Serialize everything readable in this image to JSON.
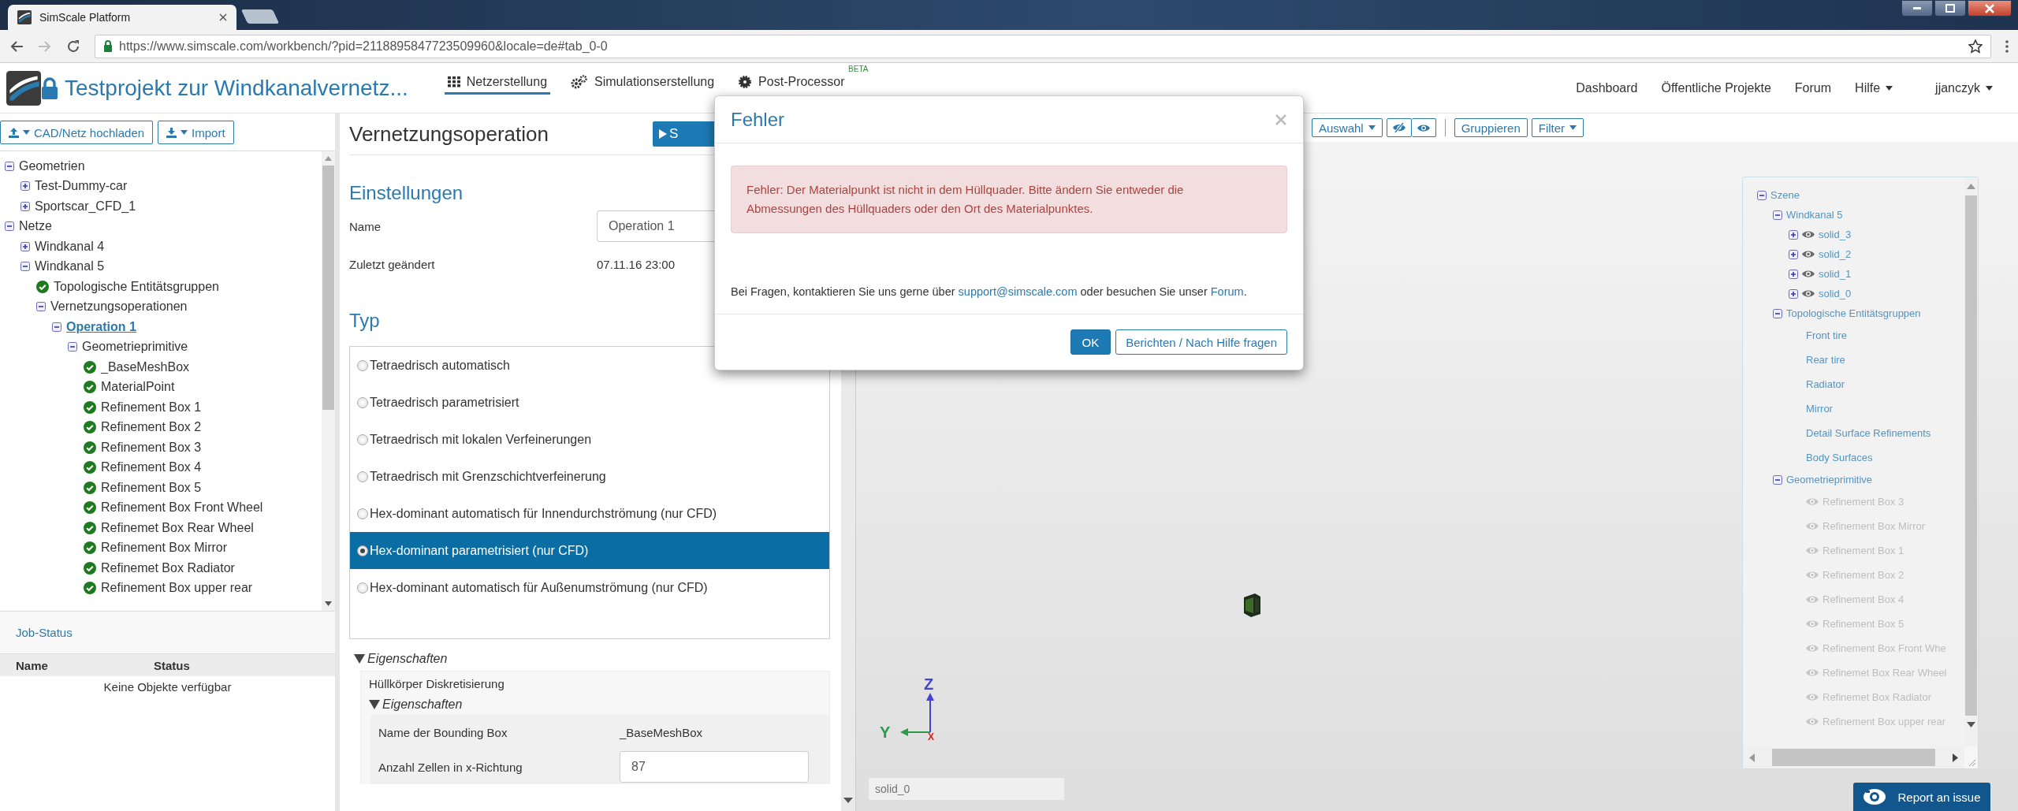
{
  "browser": {
    "tab_title": "SimScale Platform",
    "url": "https://www.simscale.com/workbench/?pid=2118895847723509960&locale=de#tab_0-0"
  },
  "header": {
    "project_title": "Testprojekt zur Windkanalvernetz...",
    "nav": [
      {
        "label": "Netzerstellung",
        "selected": true
      },
      {
        "label": "Simulationserstellung",
        "selected": false
      },
      {
        "label": "Post-Processor",
        "selected": false,
        "badge": "BETA"
      }
    ],
    "links": [
      {
        "label": "Dashboard",
        "dropdown": false
      },
      {
        "label": "Öffentliche Projekte",
        "dropdown": false
      },
      {
        "label": "Forum",
        "dropdown": false
      },
      {
        "label": "Hilfe",
        "dropdown": true
      }
    ],
    "user": "jjanczyk"
  },
  "left_panel": {
    "buttons": [
      "CAD/Netz hochladen",
      "Import"
    ],
    "tree": [
      {
        "label": "Geometrien",
        "kind": "toggle",
        "expanded": true,
        "selected": false,
        "children": [
          {
            "label": "Test-Dummy-car",
            "kind": "toggle",
            "expanded": false,
            "selected": false
          },
          {
            "label": "Sportscar_CFD_1",
            "kind": "toggle",
            "expanded": false,
            "selected": false
          }
        ]
      },
      {
        "label": "Netze",
        "kind": "toggle",
        "expanded": true,
        "selected": false,
        "children": [
          {
            "label": "Windkanal 4",
            "kind": "toggle",
            "expanded": false,
            "selected": false
          },
          {
            "label": "Windkanal 5",
            "kind": "toggle",
            "expanded": true,
            "selected": false,
            "children": [
              {
                "label": "Topologische Entitätsgruppen",
                "kind": "status",
                "selected": false
              },
              {
                "label": "Vernetzungsoperationen",
                "kind": "toggle",
                "expanded": true,
                "selected": false,
                "children": [
                  {
                    "label": "Operation 1",
                    "kind": "toggle",
                    "expanded": true,
                    "selected": true,
                    "children": [
                      {
                        "label": "Geometrieprimitive",
                        "kind": "toggle",
                        "expanded": true,
                        "selected": false,
                        "children": [
                          {
                            "label": "_BaseMeshBox",
                            "kind": "status",
                            "selected": false
                          },
                          {
                            "label": "MaterialPoint",
                            "kind": "status",
                            "selected": false
                          },
                          {
                            "label": "Refinement Box 1",
                            "kind": "status",
                            "selected": false
                          },
                          {
                            "label": "Refinement Box 2",
                            "kind": "status",
                            "selected": false
                          },
                          {
                            "label": "Refinement Box 3",
                            "kind": "status",
                            "selected": false
                          },
                          {
                            "label": "Refinement Box 4",
                            "kind": "status",
                            "selected": false
                          },
                          {
                            "label": "Refinement Box 5",
                            "kind": "status",
                            "selected": false
                          },
                          {
                            "label": "Refinement Box Front Wheel",
                            "kind": "status",
                            "selected": false
                          },
                          {
                            "label": "Refinemet Box Rear Wheel",
                            "kind": "status",
                            "selected": false
                          },
                          {
                            "label": "Refinement Box Mirror",
                            "kind": "status",
                            "selected": false
                          },
                          {
                            "label": "Refinemet Box Radiator",
                            "kind": "status",
                            "selected": false
                          },
                          {
                            "label": "Refinement Box upper rear",
                            "kind": "status",
                            "selected": false
                          }
                        ]
                      }
                    ]
                  }
                ]
              }
            ]
          }
        ]
      }
    ],
    "job_status": {
      "title": "Job-Status",
      "columns": [
        "Name",
        "Status"
      ],
      "empty_text": "Keine Objekte verfügbar"
    }
  },
  "operation": {
    "title": "Vernetzungsoperation",
    "run_button": "S",
    "settings_heading": "Einstellungen",
    "fields": [
      {
        "label": "Name",
        "kind": "input",
        "value": "Operation 1"
      },
      {
        "label": "Zuletzt geändert",
        "kind": "text",
        "value": "07.11.16 23:00"
      }
    ],
    "type_heading": "Typ",
    "type_options": [
      {
        "label": "Tetraedrisch automatisch",
        "selected": false
      },
      {
        "label": "Tetraedrisch parametrisiert",
        "selected": false
      },
      {
        "label": "Tetraedrisch mit lokalen Verfeinerungen",
        "selected": false
      },
      {
        "label": "Tetraedrisch mit Grenzschichtverfeinerung",
        "selected": false
      },
      {
        "label": "Hex-dominant automatisch für Innendurchströmung (nur CFD)",
        "selected": false
      },
      {
        "label": "Hex-dominant parametrisiert (nur CFD)",
        "selected": true
      },
      {
        "label": "Hex-dominant automatisch für Außenumströmung (nur CFD)",
        "selected": false
      }
    ],
    "properties": {
      "title": "Eigenschaften",
      "expanded": true,
      "section": "Hüllkörper Diskretisierung",
      "sub": {
        "title": "Eigenschaften",
        "expanded": true,
        "rows": [
          {
            "label": "Name der Bounding Box",
            "kind": "text",
            "value": "_BaseMeshBox"
          },
          {
            "label": "Anzahl Zellen in x-Richtung",
            "kind": "input",
            "value": "87"
          }
        ]
      }
    }
  },
  "viewer": {
    "toolbar": [
      {
        "kind": "dropdown",
        "label": "Auswahl"
      },
      {
        "kind": "visibility"
      },
      {
        "kind": "button",
        "label": "Gruppieren"
      },
      {
        "kind": "dropdown",
        "label": "Filter"
      }
    ],
    "axes": {
      "x": "X",
      "y": "Y",
      "z": "Z"
    },
    "object_field": {
      "placeholder": "solid_0"
    },
    "scene_tree": [
      {
        "label": "Szene",
        "kind": "toggle",
        "expanded": true,
        "children": [
          {
            "label": "Windkanal 5",
            "kind": "toggle",
            "expanded": true,
            "children": [
              {
                "label": "solid_3",
                "kind": "toggle",
                "expanded": false,
                "visible": true
              },
              {
                "label": "solid_2",
                "kind": "toggle",
                "expanded": false,
                "visible": true
              },
              {
                "label": "solid_1",
                "kind": "toggle",
                "expanded": false,
                "visible": true
              },
              {
                "label": "solid_0",
                "kind": "toggle",
                "expanded": false,
                "visible": true
              }
            ]
          },
          {
            "label": "Topologische Entitätsgruppen",
            "kind": "toggle",
            "expanded": true,
            "children": [
              {
                "label": "Front tire",
                "kind": "plain"
              },
              {
                "label": "Rear tire",
                "kind": "plain"
              },
              {
                "label": "Radiator",
                "kind": "plain"
              },
              {
                "label": "Mirror",
                "kind": "plain"
              },
              {
                "label": "Detail Surface Refinements",
                "kind": "plain"
              },
              {
                "label": "Body Surfaces",
                "kind": "plain"
              }
            ]
          },
          {
            "label": "Geometrieprimitive",
            "kind": "toggle",
            "expanded": true,
            "children": [
              {
                "label": "Refinement Box 3",
                "kind": "plain",
                "visible": false
              },
              {
                "label": "Refinement Box Mirror",
                "kind": "plain",
                "visible": false
              },
              {
                "label": "Refinement Box 1",
                "kind": "plain",
                "visible": false
              },
              {
                "label": "Refinement Box 2",
                "kind": "plain",
                "visible": false
              },
              {
                "label": "Refinement Box 4",
                "kind": "plain",
                "visible": false
              },
              {
                "label": "Refinement Box 5",
                "kind": "plain",
                "visible": false
              },
              {
                "label": "Refinement Box Front Whe",
                "kind": "plain",
                "visible": false
              },
              {
                "label": "Refinemet Box Rear Wheel",
                "kind": "plain",
                "visible": false
              },
              {
                "label": "Refinemet Box Radiator",
                "kind": "plain",
                "visible": false
              },
              {
                "label": "Refinement Box upper rear",
                "kind": "plain",
                "visible": false
              }
            ]
          }
        ]
      }
    ],
    "report_button": "Report an issue"
  },
  "dialog": {
    "title": "Fehler",
    "message": "Fehler: Der Materialpunkt ist nicht in dem Hüllquader. Bitte ändern Sie entweder die Abmessungen des Hüllquaders oder den Ort des Materialpunktes.",
    "help": {
      "before": "Bei Fragen, kontaktieren Sie uns gerne über ",
      "email": "support@simscale.com",
      "middle": " oder besuchen Sie unser ",
      "forum": "Forum",
      "after": "."
    },
    "buttons": [
      {
        "label": "OK",
        "primary": true
      },
      {
        "label": "Berichten / Nach Hilfe fragen",
        "primary": false
      }
    ]
  }
}
